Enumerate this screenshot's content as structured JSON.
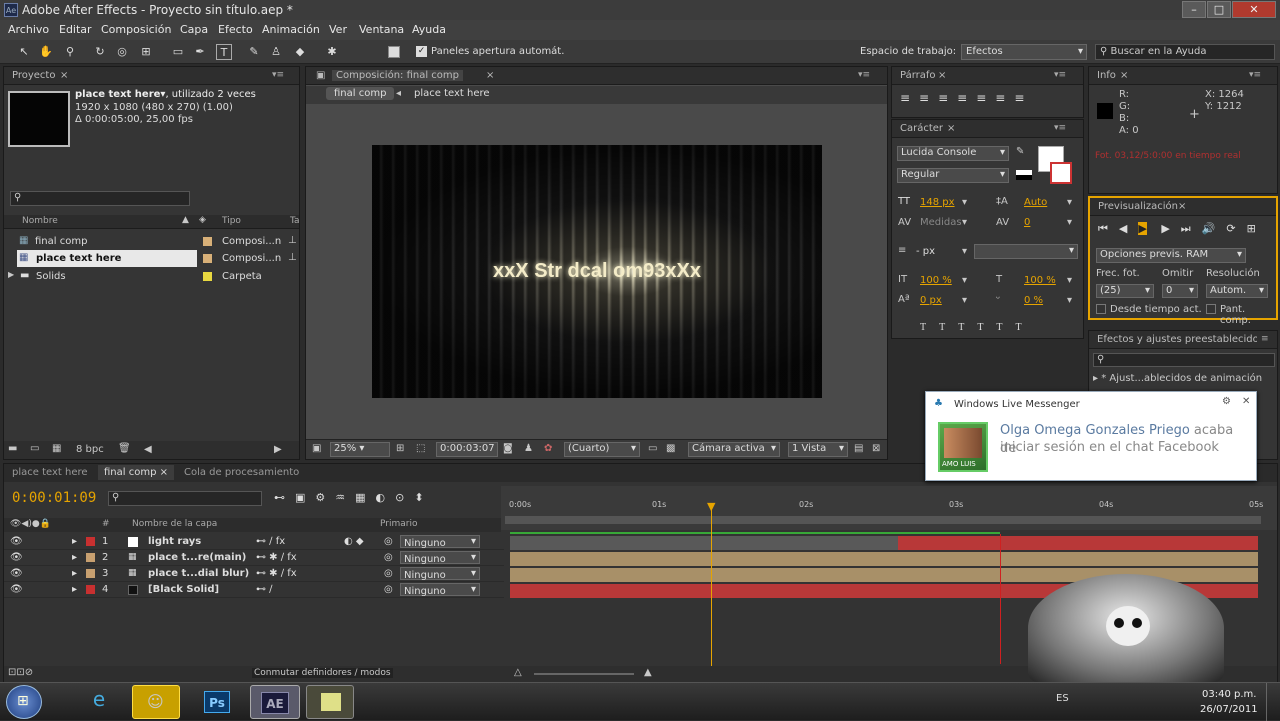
{
  "window": {
    "title": "Adobe After Effects - Proyecto sin título.aep *",
    "app_icon": "Ae"
  },
  "menu": [
    "Archivo",
    "Editar",
    "Composición",
    "Capa",
    "Efecto",
    "Animación",
    "Ver",
    "Ventana",
    "Ayuda"
  ],
  "toolbar": {
    "auto_panels": "Paneles apertura automát.",
    "workspace_label": "Espacio de trabajo:",
    "workspace_value": "Efectos",
    "help_search": "Buscar en la Ayuda"
  },
  "project": {
    "tab": "Proyecto",
    "item_name": "place text here▾",
    "item_used": ", utilizado 2 veces",
    "item_size": "1920 x 1080  (480 x 270) (1.00)",
    "item_duration": "Δ 0:00:05:00, 25,00 fps",
    "col_name": "Nombre",
    "col_type": "Tipo",
    "col_size": "Ta",
    "rows": [
      {
        "name": "final comp",
        "type": "Composi...n"
      },
      {
        "name": "place text here",
        "type": "Composi...n"
      },
      {
        "name": "Solids",
        "type": "Carpeta"
      }
    ],
    "bpc": "8 bpc"
  },
  "comp": {
    "tab": "Composición: final comp",
    "crumb1": "final comp",
    "crumb2": "place text here",
    "text": "xxX Str  dcal      om93xXx",
    "zoom": "25%",
    "timecode": "0:00:03:07",
    "resolution": "(Cuarto)",
    "camera": "Cámara activa",
    "views": "1 Vista"
  },
  "paragraph": {
    "tab": "Párrafo"
  },
  "character": {
    "tab": "Carácter",
    "font": "Lucida Console",
    "style": "Regular",
    "size": "148 px",
    "leading": "Auto",
    "kerning": "Medidas",
    "tracking": "0",
    "stroke": "- px",
    "vscale": "100 %",
    "hscale": "100 %",
    "baseline": "0 px",
    "tsume": "0 %"
  },
  "info": {
    "tab": "Info",
    "r": "R:",
    "g": "G:",
    "b": "B:",
    "a": "A: 0",
    "x": "X: 1264",
    "y": "Y: 1212",
    "warning": "Fot. 03,12/5:0:00 en tiempo real"
  },
  "preview": {
    "tab": "Previsualización",
    "ram_options": "Opciones previs. RAM",
    "frame_rate_label": "Frec. fot.",
    "skip_label": "Omitir",
    "resolution_label": "Resolución",
    "frame_rate": "(25)",
    "skip": "0",
    "resolution": "Autom.",
    "from_current": "Desde tiempo act.",
    "full_screen": "Pant. comp."
  },
  "effects": {
    "tab": "Efectos y ajustes preestablecidos",
    "item": "* Ajust...ablecidos de animación"
  },
  "notification": {
    "app": "Windows Live Messenger",
    "name": "Olga Omega Gonzales Priego",
    "message_a": " acaba de",
    "message_b": "iniciar sesión en el chat Facebook",
    "avatar_label": "AMO LUIS"
  },
  "timeline": {
    "tabs": [
      "place text here",
      "final comp",
      "Cola de procesamiento"
    ],
    "timecode": "0:00:01:09",
    "col_layer": "Nombre de la capa",
    "col_parent": "Primario",
    "col_num": "#",
    "switches": "Conmutar definidores / modos",
    "ruler": [
      "0:00s",
      "01s",
      "02s",
      "03s",
      "04s",
      "05s"
    ],
    "layers": [
      {
        "num": "1",
        "name": "light rays",
        "parent": "Ninguno",
        "color": "#c83030"
      },
      {
        "num": "2",
        "name": "place t...re(main)",
        "parent": "Ninguno",
        "color": "#c8a070"
      },
      {
        "num": "3",
        "name": "place t...dial blur)",
        "parent": "Ninguno",
        "color": "#c8a070"
      },
      {
        "num": "4",
        "name": "[Black Solid]",
        "parent": "Ninguno",
        "color": "#c83030"
      }
    ]
  },
  "taskbar": {
    "lang": "ES",
    "time": "03:40 p.m.",
    "date": "26/07/2011",
    "apps": [
      "Ps",
      "AE"
    ]
  },
  "colors": {
    "accent": "#e6a400",
    "layer_red": "#b83838",
    "layer_tan": "#a89068",
    "work_green": "#38a838"
  }
}
